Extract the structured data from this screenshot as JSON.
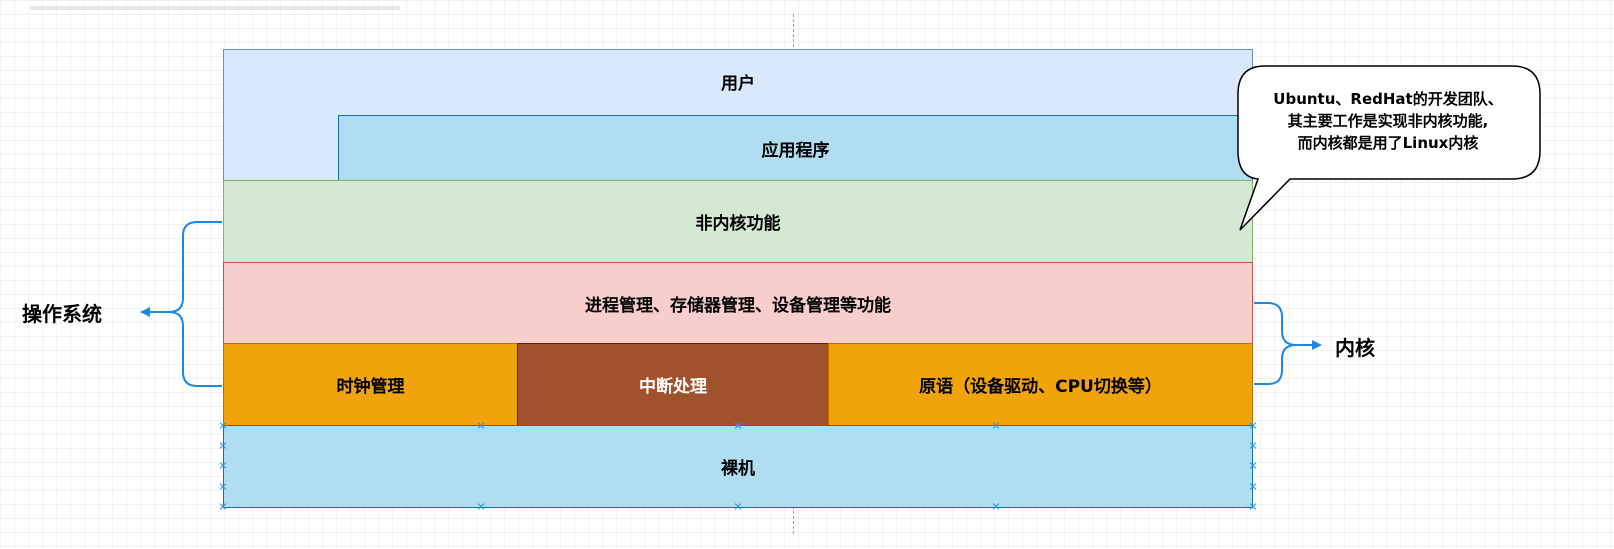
{
  "layers": {
    "user": "用户",
    "apps": "应用程序",
    "non_kernel": "非内核功能",
    "kernel_funcs": "进程管理、存储器管理、设备管理等功能",
    "clock": "时钟管理",
    "interrupt": "中断处理",
    "primitives": "原语（设备驱动、CPU切换等）",
    "hardware": "裸机"
  },
  "labels": {
    "os": "操作系统",
    "kernel": "内核"
  },
  "callout": {
    "lines": [
      "Ubuntu、RedHat的开发团队、",
      "其主要工作是实现非内核功能,",
      "而内核都是用了Linux内核"
    ]
  },
  "colors": {
    "user": "#dae8fc",
    "apps": "#b1ddf0",
    "non_kernel": "#d5e8d4",
    "kernel_funcs": "#f8cecc",
    "clock": "#f0a30a",
    "interrupt": "#a0522d",
    "primitives": "#f0a30a",
    "hardware": "#b1ddf0",
    "arrow": "#1e88e5"
  }
}
